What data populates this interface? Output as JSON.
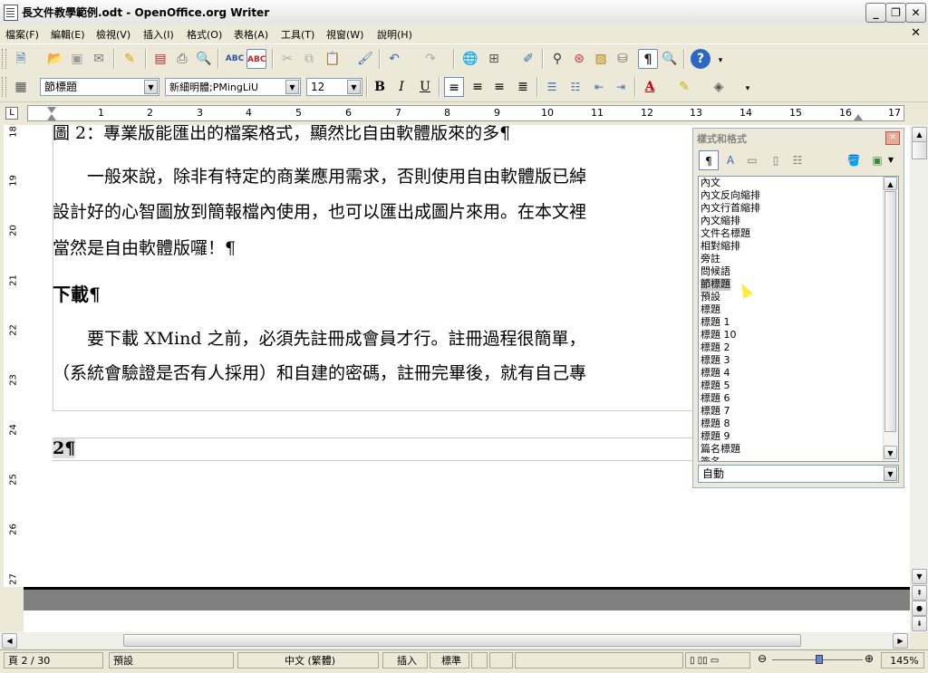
{
  "window": {
    "title": "長文件教學範例.odt - OpenOffice.org Writer",
    "minimize": "_",
    "restore": "❐",
    "close": "✕"
  },
  "menubar": {
    "items": [
      "檔案(F)",
      "編輯(E)",
      "檢視(V)",
      "插入(I)",
      "格式(O)",
      "表格(A)",
      "工具(T)",
      "視窗(W)",
      "說明(H)"
    ],
    "close": "✕"
  },
  "formatting": {
    "paragraph_style": "節標題",
    "font_name": "新細明體;PMingLiU",
    "font_size": "12"
  },
  "ruler": {
    "h_numbers": [
      "1",
      "2",
      "3",
      "4",
      "5",
      "6",
      "7",
      "8",
      "9",
      "10",
      "11",
      "12",
      "13",
      "14",
      "15",
      "16",
      "17"
    ],
    "v_numbers": [
      "18",
      "19",
      "20",
      "21",
      "22",
      "23",
      "24",
      "25",
      "26",
      "27"
    ]
  },
  "document": {
    "line_top": "圖 2：專業版能匯出的檔案格式，顯然比自由軟體版來的多¶",
    "para1_line1": "　　一般來說，除非有特定的商業應用需求，否則使用自由軟體版已綽",
    "para1_line2": "設計好的心智圖放到簡報檔內使用，也可以匯出成圖片來用。在本文裡",
    "para1_line3": "當然是自由軟體版囉！¶",
    "heading": "下載¶",
    "para2_line1": "　　要下載 XMind 之前，必須先註冊成會員才行。註冊過程很簡單，",
    "para2_line2": "（系統會驗證是否有人採用）和自建的密碼，註冊完畢後，就有自己專",
    "page_number": "2¶"
  },
  "styles_panel": {
    "title": "樣式和格式",
    "close": "✕",
    "items": [
      "內文",
      "內文反向縮排",
      "內文行首縮排",
      "內文縮排",
      "文件名標題",
      "相對縮排",
      "旁註",
      "問候語",
      "節標題",
      "預設",
      "標題",
      "標題 1",
      "標題 10",
      "標題 2",
      "標題 3",
      "標題 4",
      "標題 5",
      "標題 6",
      "標題 7",
      "標題 8",
      "標題 9",
      "篇名標題",
      "簽名"
    ],
    "selected": "節標題",
    "filter": "自動"
  },
  "status": {
    "page": "頁 2 / 30",
    "style": "預設",
    "language": "中文 (繁體)",
    "insert_mode": "插入",
    "selection_mode": "標準",
    "zoom": "145%"
  }
}
